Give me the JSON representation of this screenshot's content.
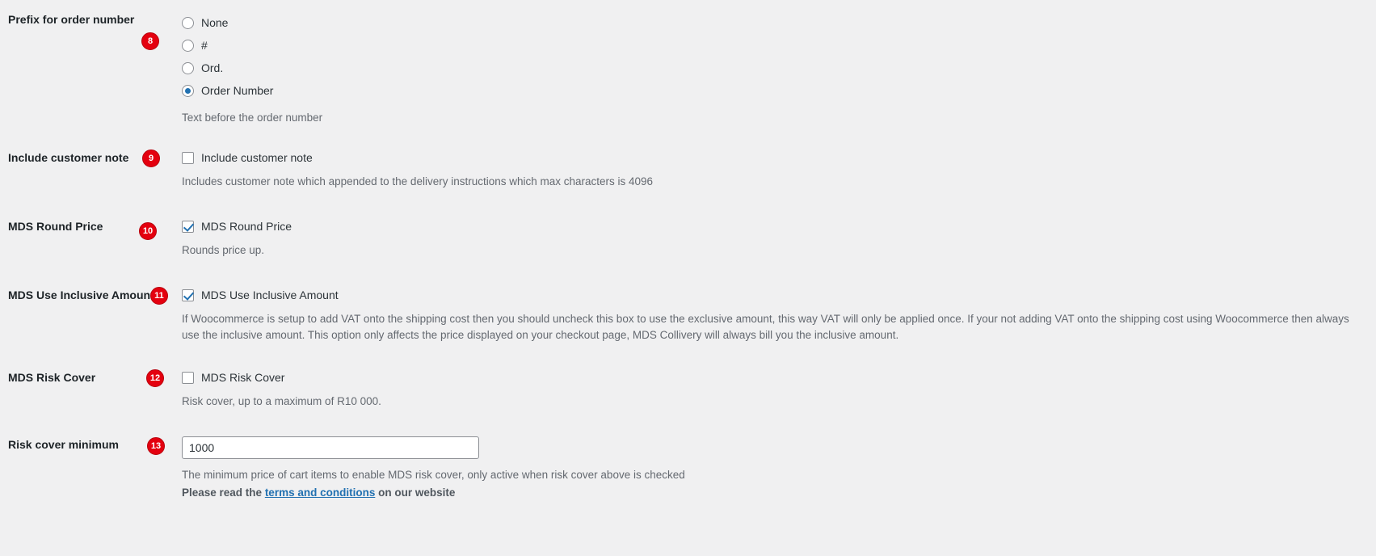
{
  "sections": [
    {
      "id": "prefix",
      "badge": "8",
      "label": "Prefix for order number",
      "type": "radio-group",
      "options": [
        {
          "label": "None",
          "checked": false
        },
        {
          "label": "#",
          "checked": false
        },
        {
          "label": "Ord.",
          "checked": false
        },
        {
          "label": "Order Number",
          "checked": true
        }
      ],
      "description": "Text before the order number"
    },
    {
      "id": "customer-note",
      "badge": "9",
      "label": "Include customer note",
      "type": "checkbox",
      "checkbox_label": "Include customer note",
      "checked": false,
      "description": "Includes customer note which appended to the delivery instructions which max characters is 4096"
    },
    {
      "id": "round-price",
      "badge": "10",
      "label": "MDS Round Price",
      "type": "checkbox",
      "checkbox_label": "MDS Round Price",
      "checked": true,
      "description": "Rounds price up."
    },
    {
      "id": "inclusive-amount",
      "badge": "11",
      "label": "MDS Use Inclusive Amount",
      "type": "checkbox",
      "checkbox_label": "MDS Use Inclusive Amount",
      "checked": true,
      "description": "If Woocommerce is setup to add VAT onto the shipping cost then you should uncheck this box to use the exclusive amount, this way VAT will only be applied once. If your not adding VAT onto the shipping cost using Woocommerce then always use the inclusive amount. This option only affects the price displayed on your checkout page, MDS Collivery will always bill you the inclusive amount."
    },
    {
      "id": "risk-cover",
      "badge": "12",
      "label": "MDS Risk Cover",
      "type": "checkbox",
      "checkbox_label": "MDS Risk Cover",
      "checked": false,
      "description": "Risk cover, up to a maximum of R10 000."
    },
    {
      "id": "risk-cover-minimum",
      "badge": "13",
      "label": "Risk cover minimum",
      "type": "text",
      "value": "1000",
      "description": "The minimum price of cart items to enable MDS risk cover, only active when risk cover above is checked",
      "note_prefix": "Please read the ",
      "note_link": "terms and conditions",
      "note_suffix": " on our website"
    }
  ],
  "colors": {
    "badge_background": "#e4000f",
    "badge_text": "#ffffff",
    "accent": "#2271b1",
    "page_background": "#f0f0f1"
  }
}
